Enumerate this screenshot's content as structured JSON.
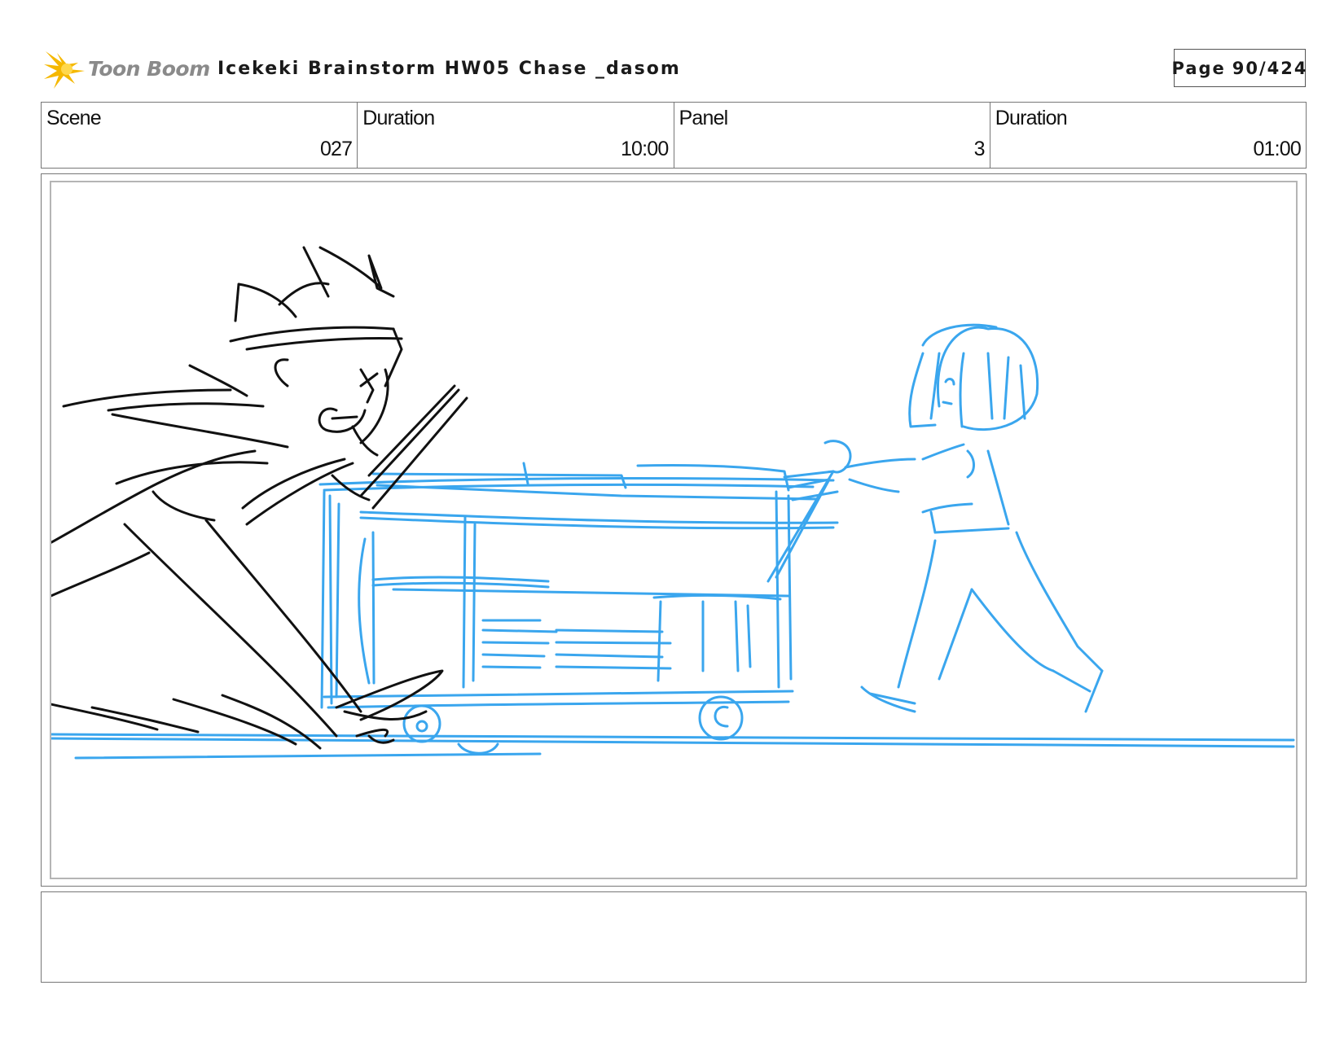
{
  "header": {
    "logo_text": "Toon Boom",
    "title": "Icekeki Brainstorm HW05 Chase _dasom",
    "page_label": "Page",
    "page_number": "90/424"
  },
  "info": [
    {
      "label": "Scene",
      "value": "027"
    },
    {
      "label": "Duration",
      "value": "10:00"
    },
    {
      "label": "Panel",
      "value": "3"
    },
    {
      "label": "Duration",
      "value": "01:00"
    }
  ],
  "colors": {
    "sketch_black": "#111111",
    "sketch_blue": "#3aa6ee",
    "logo_gold": "#f5b800"
  },
  "panel": {
    "image": "storyboard-sketch-chase-with-shopping-cart"
  },
  "notes": {
    "text": ""
  }
}
